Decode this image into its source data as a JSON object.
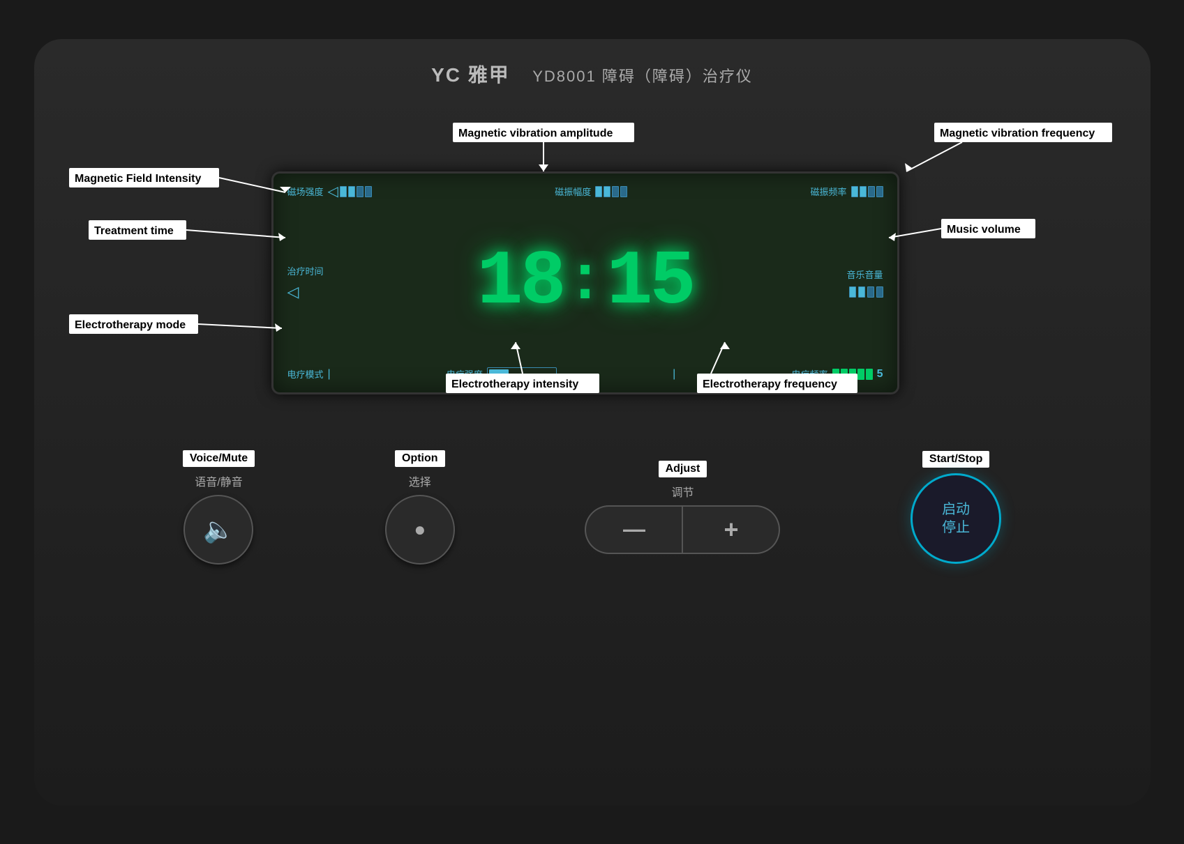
{
  "brand": {
    "logo": "YC 雅甲",
    "model": "YD8001 障碍（障碍）治疗仪"
  },
  "display": {
    "time": "18:15",
    "time_digits": [
      "1",
      "8",
      "1",
      "5"
    ],
    "indicators": {
      "magnetic_field": {
        "label": "磁场强度",
        "bars": 2,
        "total_bars": 4
      },
      "magnetic_vibration_amplitude": {
        "label": "磁振幅度",
        "bars": 2,
        "total_bars": 4
      },
      "magnetic_vibration_frequency": {
        "label": "磁振频率",
        "bars": 2,
        "total_bars": 4
      },
      "treatment_time": {
        "label": "治疗时间"
      },
      "music_volume": {
        "label": "音乐音量"
      },
      "electrotherapy_mode": {
        "label": "电疗模式"
      },
      "electrotherapy_intensity": {
        "label": "电疗强度"
      },
      "electrotherapy_frequency": {
        "label": "电疗频率",
        "value": "5"
      }
    }
  },
  "buttons": {
    "voice_mute": {
      "label_en": "Voice/Mute",
      "label_cn": "语音/静音",
      "icon": "🔈"
    },
    "option": {
      "label_en": "Option",
      "label_cn": "选择",
      "icon": "●"
    },
    "minus": {
      "label_en": "—",
      "icon": "—"
    },
    "plus": {
      "label_en": "+",
      "icon": "+"
    },
    "adjust": {
      "label_en": "Adjust",
      "label_cn": "调节"
    },
    "start_stop": {
      "label_en": "Start/Stop",
      "label_cn_line1": "启动",
      "label_cn_line2": "停止"
    }
  },
  "annotations": {
    "magnetic_field_intensity": "Magnetic Field Intensity",
    "magnetic_vibration_amplitude": "Magnetic vibration amplitude",
    "magnetic_vibration_frequency": "Magnetic vibration frequency",
    "treatment_time": "Treatment time",
    "music_volume": "Music volume",
    "electrotherapy_mode": "Electrotherapy mode",
    "electrotherapy_intensity": "Electrotherapy intensity",
    "electrotherapy_frequency": "Electrotherapy frequency"
  },
  "colors": {
    "accent_cyan": "#4ab8d8",
    "display_green": "#00cc66",
    "start_stop_ring": "#00aacc",
    "bg_dark": "#1c1c1c",
    "display_bg": "#1a2a1a"
  }
}
